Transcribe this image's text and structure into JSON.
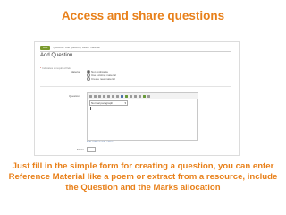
{
  "header": {
    "title": "Access and share questions"
  },
  "app": {
    "topbar": {
      "tag": "Add",
      "crumb": "Question: Add question, attach material"
    },
    "page_title": "Add Question",
    "required_note": "Indicates a required field",
    "material": {
      "label": "Material",
      "options": [
        {
          "label": "Not applicable",
          "selected": true
        },
        {
          "label": "Use existing material",
          "selected": false
        },
        {
          "label": "Create new material",
          "selected": false
        }
      ]
    },
    "question": {
      "label": "Question",
      "format_value": "Normal paragraph",
      "toolbar_icons": [
        "bold-icon",
        "italic-icon",
        "underline-icon",
        "list-icon",
        "list-ordered-icon",
        "indent-icon",
        "outdent-icon",
        "link-icon",
        "image-icon",
        "table-icon",
        "undo-icon",
        "redo-icon",
        "html-icon",
        "fullscreen-icon"
      ]
    },
    "editor_link": "Edit without rich editor",
    "marks": {
      "label": "Marks",
      "value": ""
    }
  },
  "caption": {
    "line1": "Just fill in the simple form for creating a question, you can enter",
    "line2": "Reference Material like a poem or extract from a resource, include",
    "line3": "the Question and the Marks allocation"
  },
  "colors": {
    "accent": "#e8801a",
    "brand": "#7a9a2c"
  }
}
